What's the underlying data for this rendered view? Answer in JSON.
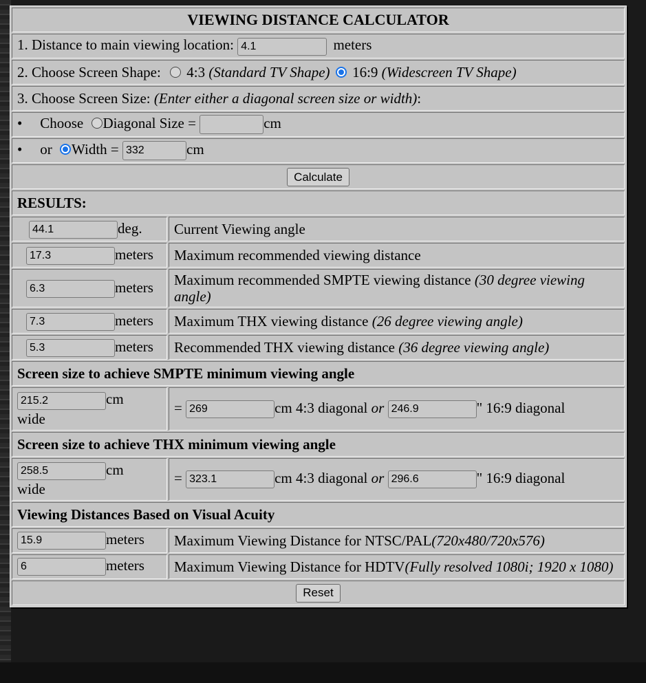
{
  "title": "VIEWING DISTANCE CALCULATOR",
  "distance": {
    "label": "1. Distance to main viewing location:",
    "value": "4.1",
    "unit": "meters"
  },
  "shape": {
    "label": "2. Choose Screen Shape:",
    "opt1_ratio": "4:3",
    "opt1_desc": "(Standard TV Shape)",
    "opt2_ratio": "16:9",
    "opt2_desc": "(Widescreen TV Shape)",
    "selected": "16:9"
  },
  "size": {
    "label": "3. Choose Screen Size:",
    "label_note": "(Enter either a diagonal screen size or width)",
    "label_end": ":",
    "choose_text": "Choose",
    "diagonal_label": "Diagonal Size =",
    "diagonal_value": "",
    "diagonal_unit": "cm",
    "or_text": "or",
    "width_label": "Width =",
    "width_value": "332",
    "width_unit": "cm",
    "selected": "width"
  },
  "calculate_label": "Calculate",
  "results_heading": "RESULTS:",
  "results": [
    {
      "value": "44.1",
      "unit": "deg.",
      "desc": "Current Viewing angle",
      "note": ""
    },
    {
      "value": "17.3",
      "unit": "meters",
      "desc": "Maximum recommended viewing distance",
      "note": ""
    },
    {
      "value": "6.3",
      "unit": "meters",
      "desc": "Maximum recommended SMPTE viewing distance",
      "note": "(30 degree viewing angle)"
    },
    {
      "value": "7.3",
      "unit": "meters",
      "desc": "Maximum THX viewing distance",
      "note": "(26 degree viewing angle)"
    },
    {
      "value": "5.3",
      "unit": "meters",
      "desc": "Recommended THX viewing distance",
      "note": "(36 degree viewing angle)"
    }
  ],
  "smpte": {
    "heading": "Screen size to achieve SMPTE minimum viewing angle",
    "width_value": "215.2",
    "width_unit": "cm",
    "wide": "wide",
    "eq": "=",
    "diag43": "269",
    "diag43_label": "cm 4:3 diagonal",
    "or": "or",
    "diag169": "246.9",
    "diag169_label": "\" 16:9 diagonal"
  },
  "thx": {
    "heading": "Screen size to achieve THX minimum viewing angle",
    "width_value": "258.5",
    "width_unit": "cm",
    "wide": "wide",
    "eq": "=",
    "diag43": "323.1",
    "diag43_label": "cm 4:3 diagonal",
    "or": "or",
    "diag169": "296.6",
    "diag169_label": "\" 16:9 diagonal"
  },
  "acuity": {
    "heading": "Viewing Distances Based on Visual Acuity",
    "rows": [
      {
        "value": "15.9",
        "unit": "meters",
        "desc": "Maximum Viewing Distance for NTSC/PAL",
        "note": "(720x480/720x576)"
      },
      {
        "value": "6",
        "unit": "meters",
        "desc": "Maximum Viewing Distance for HDTV",
        "note": "(Fully resolved 1080i; 1920 x 1080)"
      }
    ]
  },
  "reset_label": "Reset"
}
